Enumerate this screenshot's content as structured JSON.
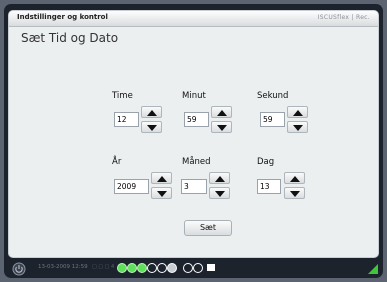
{
  "window": {
    "title": "Indstillinger og kontrol",
    "brand": "ISCUSflex | Rec."
  },
  "heading": "Sæt Tid og Dato",
  "time": {
    "hour": {
      "label": "Time",
      "value": "12"
    },
    "minute": {
      "label": "Minut",
      "value": "59"
    },
    "second": {
      "label": "Sekund",
      "value": "59"
    }
  },
  "date": {
    "year": {
      "label": "År",
      "value": "2009"
    },
    "month": {
      "label": "Måned",
      "value": "3"
    },
    "day": {
      "label": "Dag",
      "value": "13"
    }
  },
  "set_button": "Sæt",
  "statusbar": {
    "datetime": "13-03-2009 12:59",
    "status_text": "□ □ □ 4",
    "colors": {
      "active": "#5fe05a",
      "inactive": "#ffffff",
      "accent": "#42c43d"
    }
  }
}
